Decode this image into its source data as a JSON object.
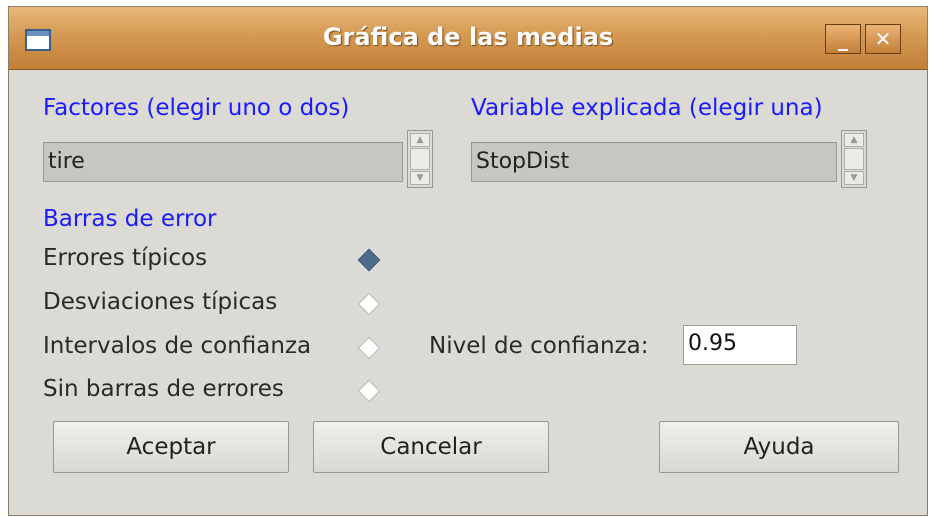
{
  "window": {
    "title": "Gráfica de las medias",
    "minimize_glyph": "_",
    "close_glyph": "✕"
  },
  "factors": {
    "label": "Factores (elegir uno o dos)",
    "items": [
      "tire"
    ]
  },
  "response": {
    "label": "Variable explicada (elegir una)",
    "items": [
      "StopDist"
    ]
  },
  "error_bars": {
    "label": "Barras de error",
    "options": [
      {
        "label": "Errores típicos",
        "selected": true
      },
      {
        "label": "Desviaciones típicas",
        "selected": false
      },
      {
        "label": "Intervalos de confianza",
        "selected": false
      },
      {
        "label": "Sin barras de errores",
        "selected": false
      }
    ]
  },
  "confidence": {
    "label": "Nivel de confianza:",
    "value": "0.95"
  },
  "buttons": {
    "ok": "Aceptar",
    "cancel": "Cancelar",
    "help": "Ayuda"
  },
  "colors": {
    "accent_label": "#1a1aff",
    "titlebar": "#d49a52",
    "radio_selected": "#4e6d8c"
  }
}
